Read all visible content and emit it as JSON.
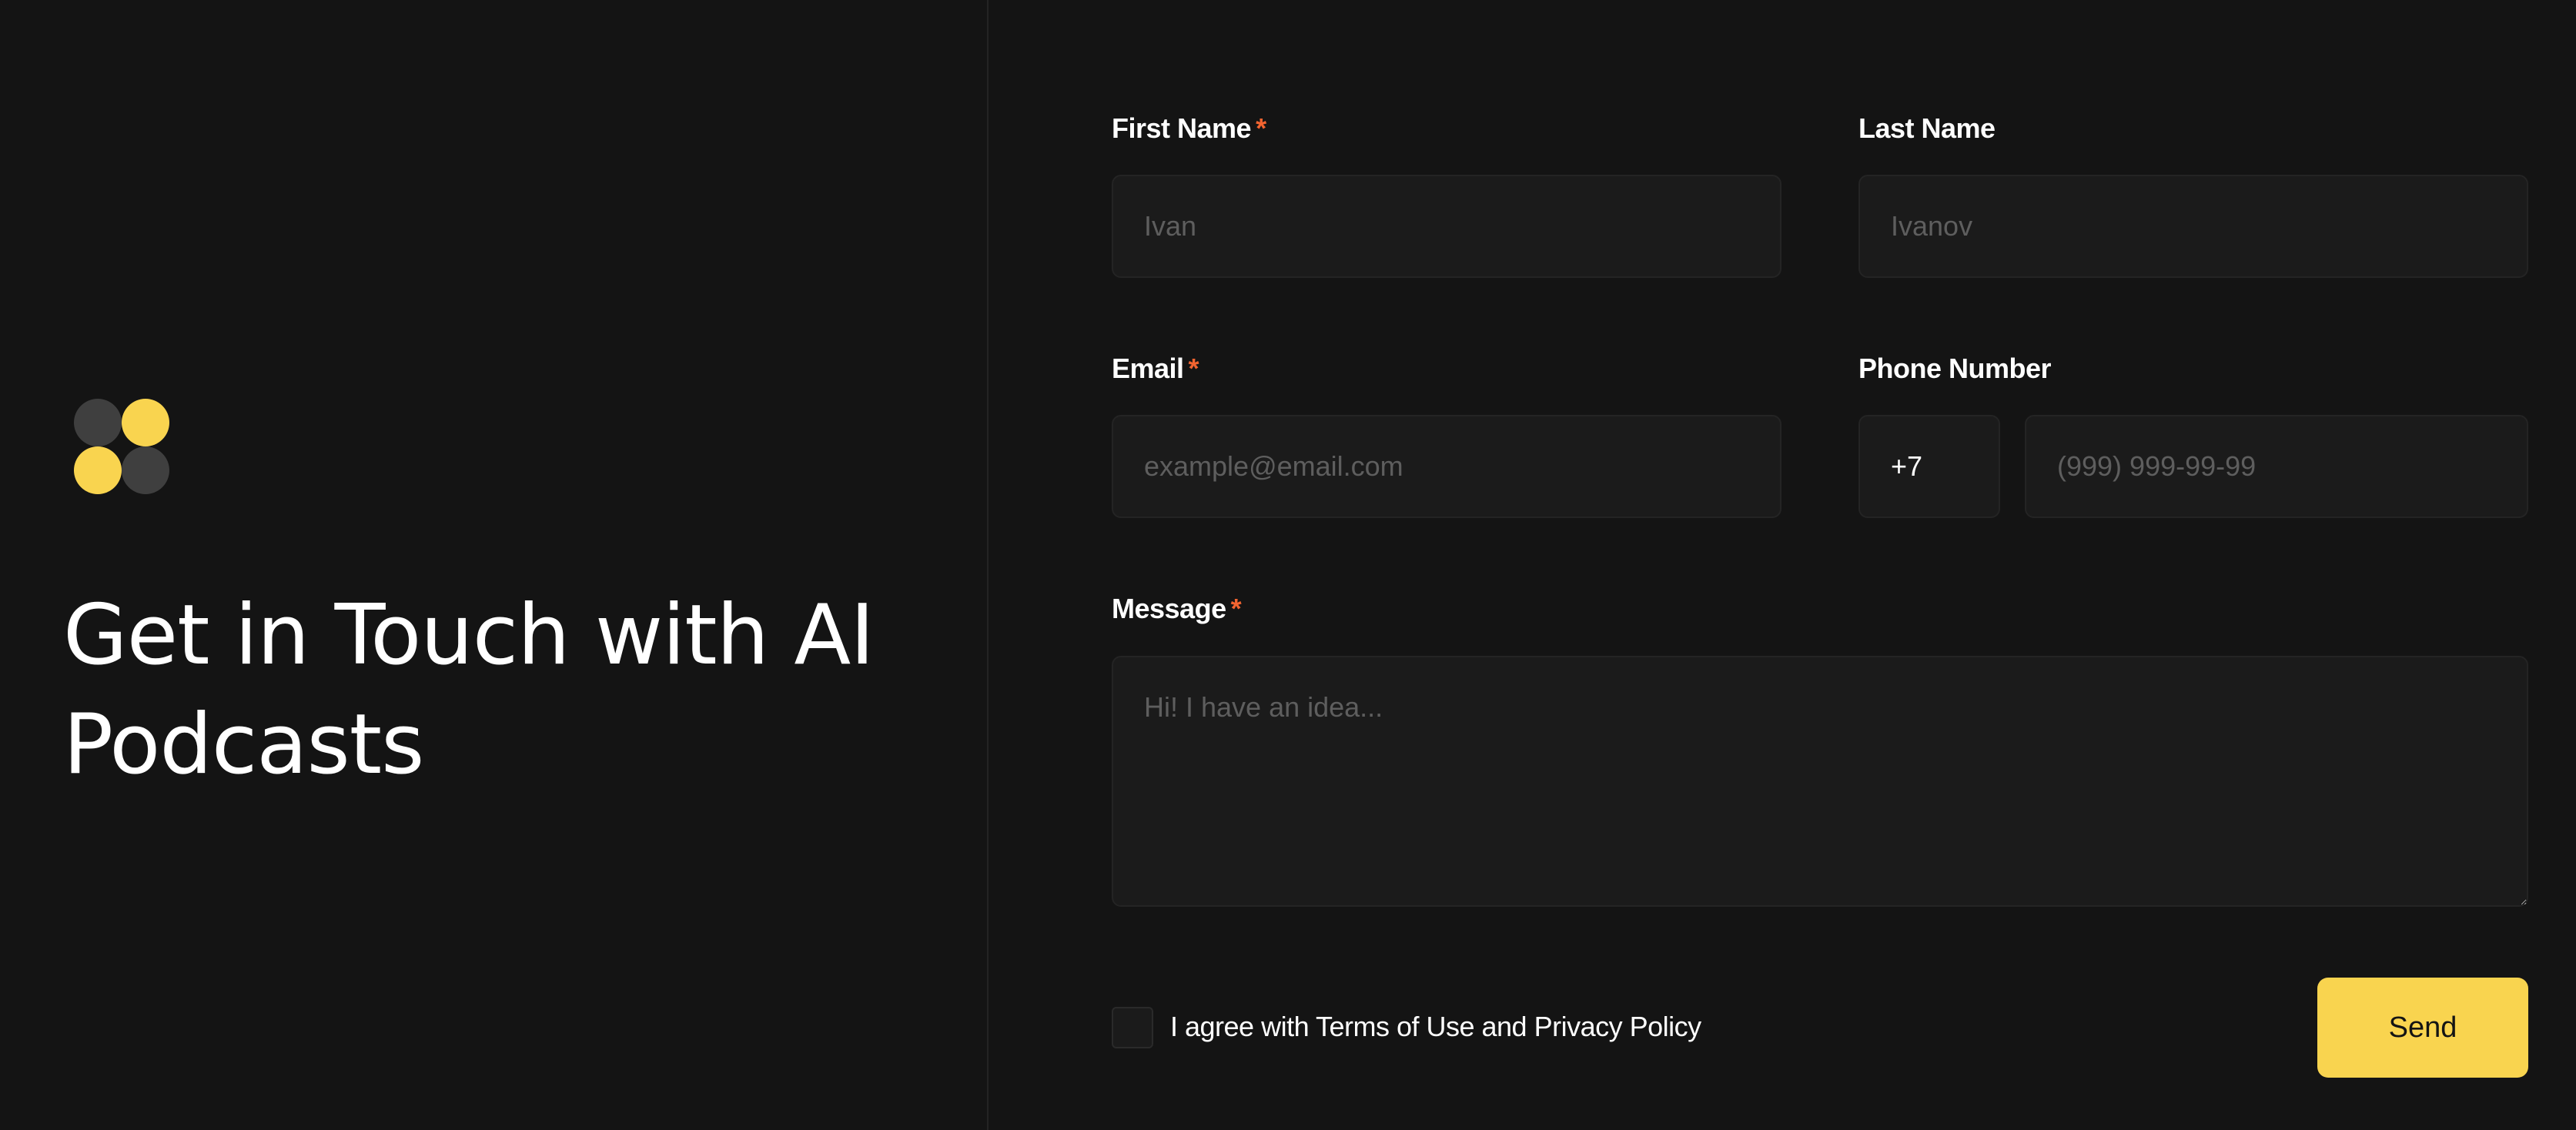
{
  "hero": {
    "title": "Get in Touch with AI Podcasts",
    "logo_colors": {
      "dark": "#3f3f3f",
      "accent": "#f9d44f"
    }
  },
  "form": {
    "first_name": {
      "label": "First Name",
      "required_mark": "*",
      "placeholder": "Ivan"
    },
    "last_name": {
      "label": "Last Name",
      "placeholder": "Ivanov"
    },
    "email": {
      "label": "Email",
      "required_mark": "*",
      "placeholder": "example@email.com"
    },
    "phone": {
      "label": "Phone Number",
      "prefix": "+7",
      "placeholder": "(999) 999-99-99"
    },
    "message": {
      "label": "Message",
      "required_mark": "*",
      "placeholder": "Hi! I have an idea..."
    },
    "agree_label": "I agree with Terms of Use and Privacy Policy",
    "send_label": "Send"
  },
  "colors": {
    "background": "#141414",
    "input_bg": "#1b1b1b",
    "accent": "#f9d44f",
    "required": "#f26430"
  }
}
